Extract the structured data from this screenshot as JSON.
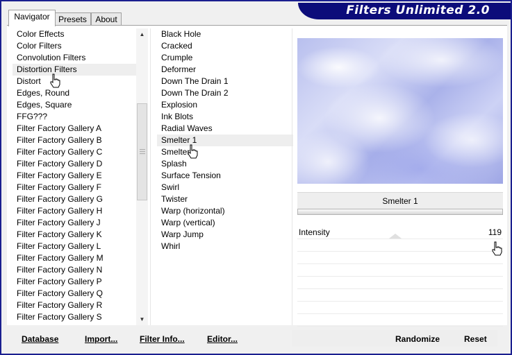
{
  "header": {
    "title": "Filters Unlimited 2.0"
  },
  "tabs": [
    {
      "label": "Navigator",
      "active": true
    },
    {
      "label": "Presets",
      "active": false
    },
    {
      "label": "About",
      "active": false
    }
  ],
  "categories": {
    "items": [
      "Color Effects",
      "Color Filters",
      "Convolution Filters",
      "Distortion Filters",
      "Distort",
      "Edges, Round",
      "Edges, Square",
      "FFG???",
      "Filter Factory Gallery A",
      "Filter Factory Gallery B",
      "Filter Factory Gallery C",
      "Filter Factory Gallery D",
      "Filter Factory Gallery E",
      "Filter Factory Gallery F",
      "Filter Factory Gallery G",
      "Filter Factory Gallery H",
      "Filter Factory Gallery J",
      "Filter Factory Gallery K",
      "Filter Factory Gallery L",
      "Filter Factory Gallery M",
      "Filter Factory Gallery N",
      "Filter Factory Gallery P",
      "Filter Factory Gallery Q",
      "Filter Factory Gallery R",
      "Filter Factory Gallery S"
    ],
    "selected": "Distortion Filters"
  },
  "filters": {
    "items": [
      "Black Hole",
      "Cracked",
      "Crumple",
      "Deformer",
      "Down The Drain 1",
      "Down The Drain 2",
      "Explosion",
      "Ink Blots",
      "Radial Waves",
      "Smelter 1",
      "Smelter",
      "Splash",
      "Surface Tension",
      "Swirl",
      "Twister",
      "Warp (horizontal)",
      "Warp (vertical)",
      "Warp Jump",
      "Whirl"
    ],
    "selected": "Smelter 1"
  },
  "params": {
    "title": "Smelter 1",
    "rows": [
      {
        "label": "Intensity",
        "value": "119"
      }
    ]
  },
  "footer": {
    "database": "Database",
    "import": "Import...",
    "filter_info": "Filter Info...",
    "editor": "Editor...",
    "randomize": "Randomize",
    "reset": "Reset"
  },
  "icons": {
    "cursor": "hand-pointer-icon",
    "scroll_up": "arrow-up-icon",
    "scroll_down": "arrow-down-icon"
  },
  "colors": {
    "frame": "#1a1f8f",
    "banner": "#0c0c7a",
    "preview": "#b8bfee"
  }
}
